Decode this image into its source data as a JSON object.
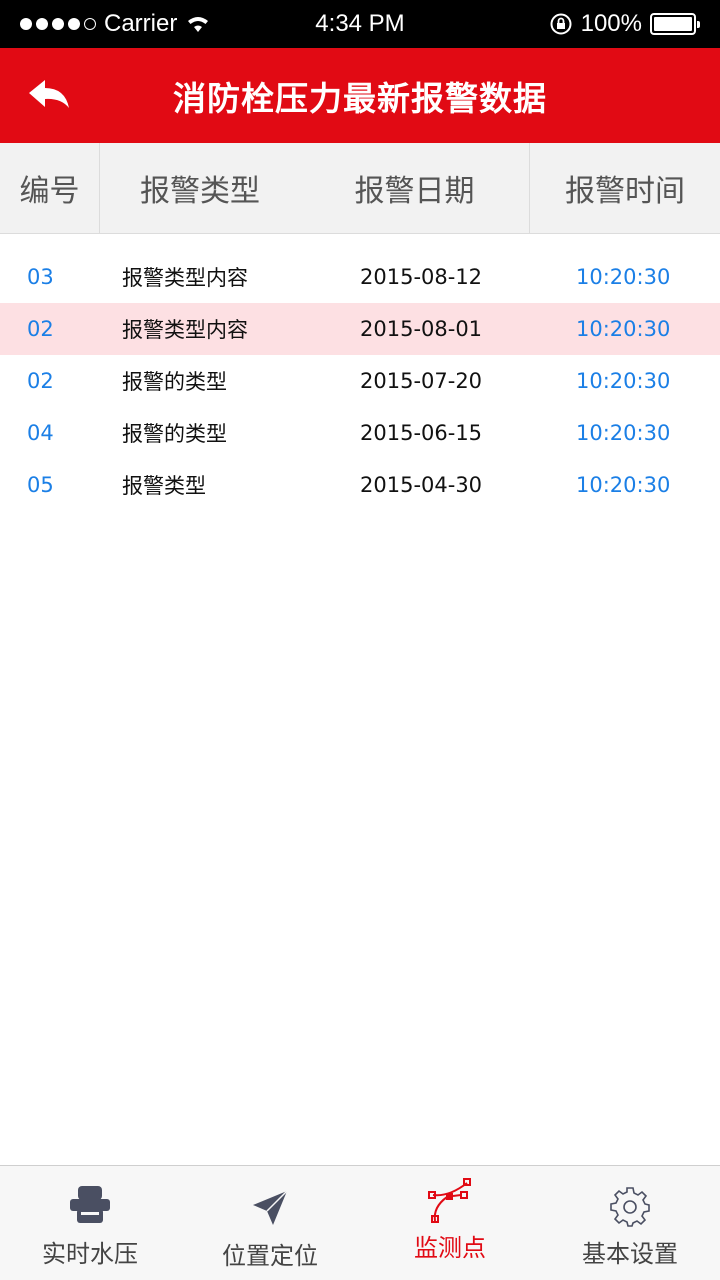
{
  "status_bar": {
    "carrier": "Carrier",
    "time": "4:34 PM",
    "battery": "100%"
  },
  "header": {
    "title": "消防栓压力最新报警数据",
    "back_icon": "back-arrow-icon"
  },
  "columns": {
    "id": "编号",
    "type": "报警类型",
    "date": "报警日期",
    "time": "报警时间"
  },
  "rows": [
    {
      "id": "03",
      "type": "报警类型内容",
      "date": "2015-08-12",
      "time": "10:20:30"
    },
    {
      "id": "02",
      "type": "报警类型内容",
      "date": "2015-08-01",
      "time": "10:20:30"
    },
    {
      "id": "02",
      "type": "报警的类型",
      "date": "2015-07-20",
      "time": "10:20:30"
    },
    {
      "id": "04",
      "type": "报警的类型",
      "date": "2015-06-15",
      "time": "10:20:30"
    },
    {
      "id": "05",
      "type": "报警类型",
      "date": "2015-04-30",
      "time": "10:20:30"
    }
  ],
  "tabs": [
    {
      "label": "实时水压",
      "icon": "pressure-gauge-icon"
    },
    {
      "label": "位置定位",
      "icon": "location-arrow-icon"
    },
    {
      "label": "监测点",
      "icon": "monitor-points-icon"
    },
    {
      "label": "基本设置",
      "icon": "gear-icon"
    }
  ],
  "colors": {
    "brand_red": "#e10a14",
    "highlight_row": "#fde0e3",
    "link_blue": "#1b7fe6"
  }
}
